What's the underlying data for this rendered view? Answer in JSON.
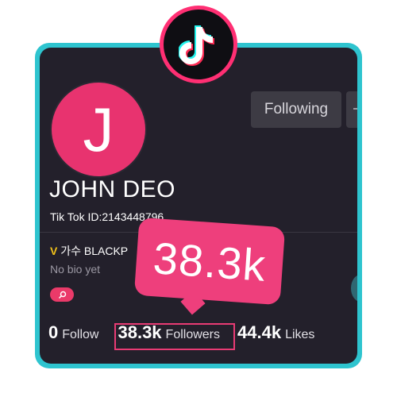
{
  "profile": {
    "avatar_letter": "J",
    "name": "JOHN DEO",
    "tiktok_id": "Tik Tok ID:2143448796",
    "verified_mark": "V",
    "verified_text": "가수 BLACKP",
    "bio": "No bio yet",
    "following_button": "Following"
  },
  "stats": {
    "follow_count": "0",
    "follow_label": "Follow",
    "followers_count": "38.3k",
    "followers_label": "Followers",
    "likes_count": "44.4k",
    "likes_label": "Likes"
  },
  "callout": {
    "text": "38.3k"
  },
  "colors": {
    "frame": "#2ec4cf",
    "card": "#23202b",
    "accent_pink": "#ee3f7c",
    "verified_gold": "#f2c21a"
  },
  "icons": [
    "tiktok-logo-icon",
    "search-icon",
    "more-icon"
  ]
}
